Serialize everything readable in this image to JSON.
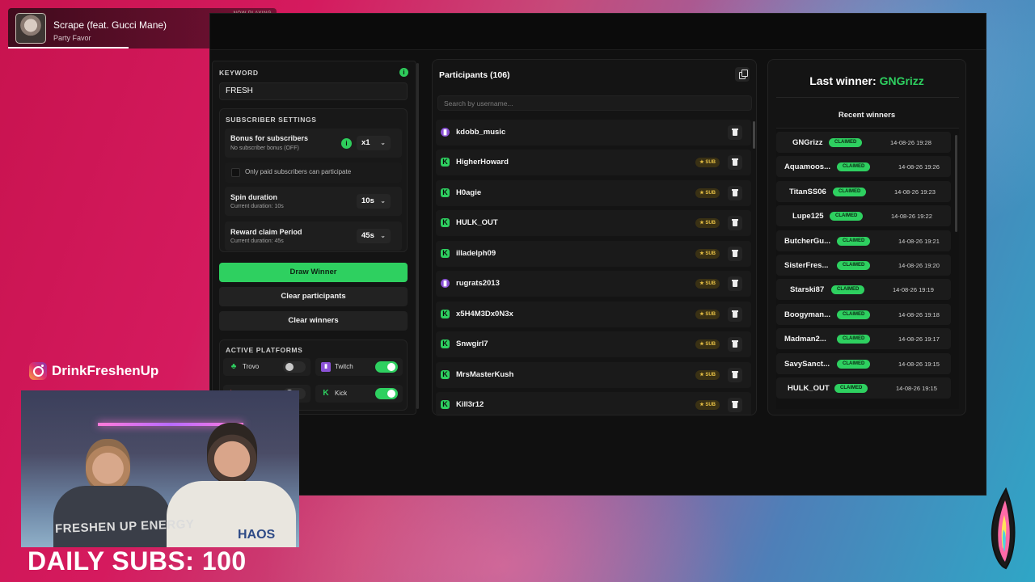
{
  "now_playing": {
    "label": "NOW PLAYING",
    "title": "Scrape (feat. Gucci Mane)",
    "artist": "Party Favor",
    "progress_fraction": 0.45
  },
  "keyword": {
    "label": "KEYWORD",
    "info_icon": "i",
    "value": "FRESH"
  },
  "subscriber_settings": {
    "label": "SUBSCRIBER SETTINGS",
    "bonus": {
      "title": "Bonus for subscribers",
      "subtitle": "No subscriber bonus (OFF)",
      "value": "x1"
    },
    "only_paid": {
      "label": "Only paid subscribers can participate",
      "checked": false
    },
    "spin": {
      "title": "Spin duration",
      "subtitle": "Current duration: 10s",
      "value": "10s"
    },
    "reward": {
      "title": "Reward claim Period",
      "subtitle": "Current duration: 45s",
      "value": "45s"
    }
  },
  "buttons": {
    "draw": "Draw Winner",
    "clear_participants": "Clear participants",
    "clear_winners": "Clear winners"
  },
  "platforms": {
    "label": "ACTIVE PLATFORMS",
    "items": [
      {
        "name": "Trovo",
        "icon": "trovo-icon",
        "enabled": false
      },
      {
        "name": "Twitch",
        "icon": "twitch-icon",
        "enabled": true
      },
      {
        "name": "",
        "icon": "youtube-icon",
        "enabled": false
      },
      {
        "name": "Kick",
        "icon": "kick-icon",
        "enabled": true
      }
    ]
  },
  "participants": {
    "title": "Participants (106)",
    "search_placeholder": "Search by username...",
    "sub_badge": "SUB",
    "rows": [
      {
        "name": "kdobb_music",
        "platform": "twitch",
        "sub": false
      },
      {
        "name": "HigherHoward",
        "platform": "kick",
        "sub": true
      },
      {
        "name": "H0agie",
        "platform": "kick",
        "sub": true
      },
      {
        "name": "HULK_OUT",
        "platform": "kick",
        "sub": true
      },
      {
        "name": "illadelph09",
        "platform": "kick",
        "sub": true
      },
      {
        "name": "rugrats2013",
        "platform": "twitch",
        "sub": true
      },
      {
        "name": "x5H4M3Dx0N3x",
        "platform": "kick",
        "sub": true
      },
      {
        "name": "Snwgirl7",
        "platform": "kick",
        "sub": true
      },
      {
        "name": "MrsMasterKush",
        "platform": "kick",
        "sub": true
      },
      {
        "name": "Kill3r12",
        "platform": "kick",
        "sub": true
      }
    ]
  },
  "winners": {
    "last_label": "Last winner: ",
    "last_name": "GNGrizz",
    "recent_title": "Recent winners",
    "status_label": "CLAIMED",
    "rows": [
      {
        "name": "GNGrizz",
        "date": "14-08-26 19:28"
      },
      {
        "name": "Aquamoos...",
        "date": "14-08-26 19:26"
      },
      {
        "name": "TitanSS06",
        "date": "14-08-26 19:23"
      },
      {
        "name": "Lupe125",
        "date": "14-08-26 19:22"
      },
      {
        "name": "ButcherGu...",
        "date": "14-08-26 19:21"
      },
      {
        "name": "SisterFres...",
        "date": "14-08-26 19:20"
      },
      {
        "name": "Starski87",
        "date": "14-08-26 19:19"
      },
      {
        "name": "Boogyman...",
        "date": "14-08-26 19:18"
      },
      {
        "name": "Madman2...",
        "date": "14-08-26 19:17"
      },
      {
        "name": "SavySanct...",
        "date": "14-08-26 19:15"
      },
      {
        "name": "HULK_OUT",
        "date": "14-08-26 19:15"
      }
    ]
  },
  "overlay": {
    "instagram_handle": "DrinkFreshenUp",
    "daily_subs": "DAILY SUBS: 100",
    "cam_shirt_a": "FRESHEN UP ENERGY",
    "cam_shirt_b": "HAOS"
  },
  "colors": {
    "accent_green": "#2ed060",
    "twitch_purple": "#8b52d6",
    "sub_gold": "#e7c045"
  }
}
